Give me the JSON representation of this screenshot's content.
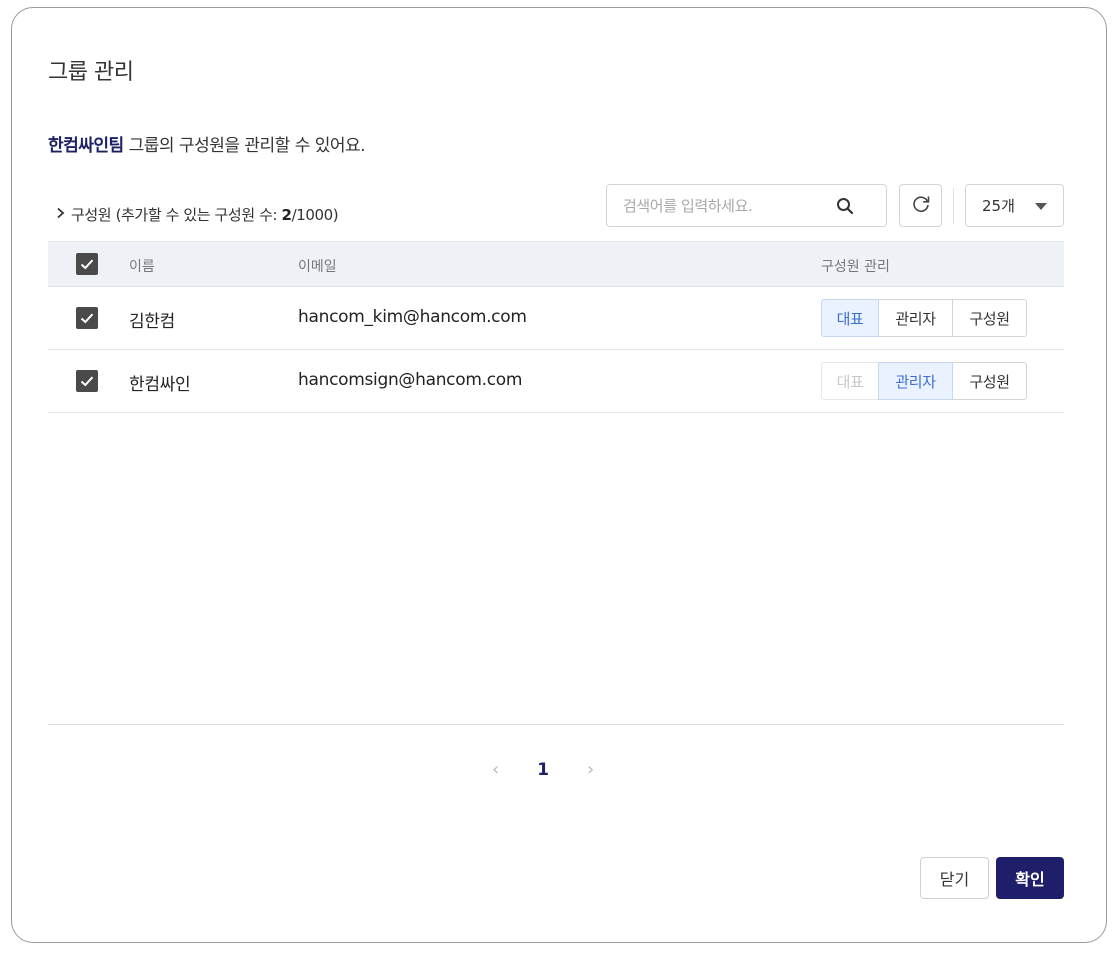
{
  "dialog": {
    "title": "그룹 관리",
    "description": {
      "group_name": "한컴싸인팀",
      "suffix": " 그룹의 구성원을 관리할 수 있어요."
    }
  },
  "toolbar": {
    "summary_prefix": "구성원 (추가할 수 있는 구성원 수: ",
    "summary_count": "2",
    "summary_suffix": "/1000)",
    "search_placeholder": "검색어를 입력하세요.",
    "page_size": "25개"
  },
  "table": {
    "headers": {
      "name": "이름",
      "email": "이메일",
      "role": "구성원 관리"
    },
    "rows": [
      {
        "checked": true,
        "name": "김한컴",
        "email": "hancom_kim@hancom.com",
        "roles": [
          {
            "label": "대표",
            "state": "active"
          },
          {
            "label": "관리자",
            "state": "normal"
          },
          {
            "label": "구성원",
            "state": "normal"
          }
        ]
      },
      {
        "checked": true,
        "name": "한컴싸인",
        "email": "hancomsign@hancom.com",
        "roles": [
          {
            "label": "대표",
            "state": "disabled"
          },
          {
            "label": "관리자",
            "state": "active"
          },
          {
            "label": "구성원",
            "state": "normal"
          }
        ]
      }
    ]
  },
  "pagination": {
    "prev": "‹",
    "current": "1",
    "next": "›"
  },
  "footer": {
    "close_label": "닫기",
    "confirm_label": "확인"
  },
  "colors": {
    "brand": "#1f1e6b",
    "active_role_bg": "#eaf2ff",
    "active_role_text": "#3c6fd0"
  },
  "icons": {
    "search": "search-icon",
    "refresh": "refresh-icon",
    "dropdown": "caret-down-icon",
    "check": "check-icon"
  }
}
